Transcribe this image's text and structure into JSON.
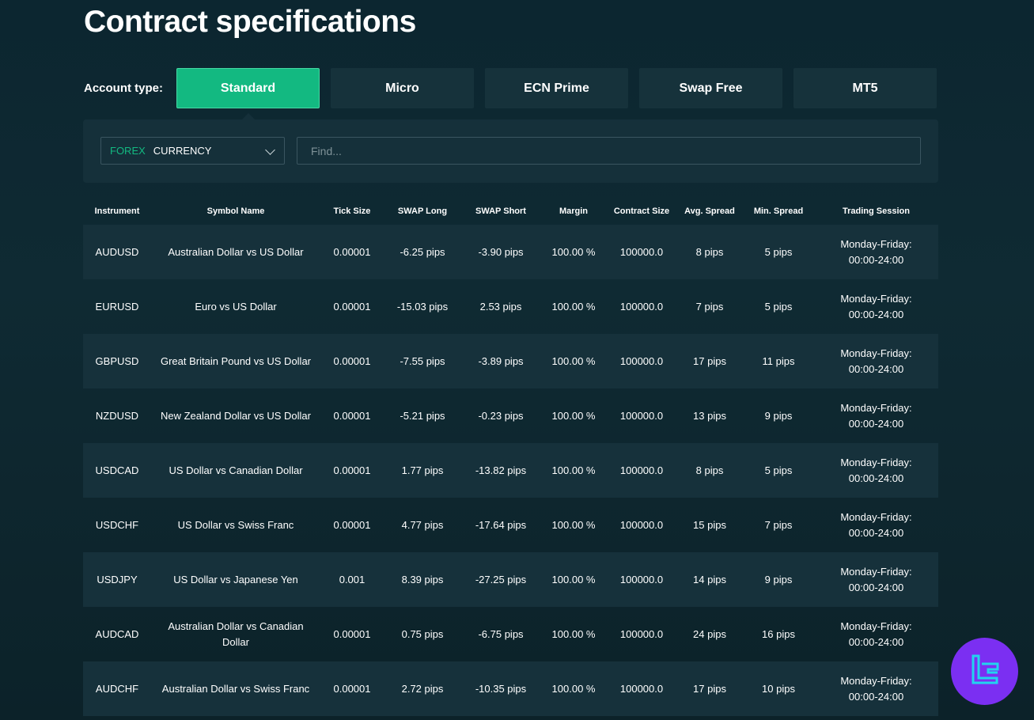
{
  "page": {
    "title": "Contract specifications"
  },
  "account": {
    "label": "Account type:",
    "tabs": [
      {
        "label": "Standard",
        "active": true
      },
      {
        "label": "Micro",
        "active": false
      },
      {
        "label": "ECN Prime",
        "active": false
      },
      {
        "label": "Swap Free",
        "active": false
      },
      {
        "label": "MT5",
        "active": false
      }
    ]
  },
  "filter": {
    "category_tag": "FOREX",
    "category_value": "CURRENCY",
    "find_placeholder": "Find..."
  },
  "table": {
    "headers": [
      "Instrument",
      "Symbol Name",
      "Tick Size",
      "SWAP Long",
      "SWAP Short",
      "Margin",
      "Contract Size",
      "Avg. Spread",
      "Min. Spread",
      "Trading Session"
    ],
    "rows": [
      {
        "instrument": "AUDUSD",
        "symbol": "Australian Dollar vs US Dollar",
        "tick": "0.00001",
        "swap_long": "-6.25 pips",
        "swap_short": "-3.90 pips",
        "margin": "100.00 %",
        "contract": "100000.0",
        "avg": "8 pips",
        "min": "5 pips",
        "session1": "Monday-Friday:",
        "session2": "00:00-24:00"
      },
      {
        "instrument": "EURUSD",
        "symbol": "Euro vs US Dollar",
        "tick": "0.00001",
        "swap_long": "-15.03 pips",
        "swap_short": "2.53 pips",
        "margin": "100.00 %",
        "contract": "100000.0",
        "avg": "7 pips",
        "min": "5 pips",
        "session1": "Monday-Friday:",
        "session2": "00:00-24:00"
      },
      {
        "instrument": "GBPUSD",
        "symbol": "Great Britain Pound vs US Dollar",
        "tick": "0.00001",
        "swap_long": "-7.55 pips",
        "swap_short": "-3.89 pips",
        "margin": "100.00 %",
        "contract": "100000.0",
        "avg": "17 pips",
        "min": "11 pips",
        "session1": "Monday-Friday:",
        "session2": "00:00-24:00"
      },
      {
        "instrument": "NZDUSD",
        "symbol": "New Zealand Dollar vs US Dollar",
        "tick": "0.00001",
        "swap_long": "-5.21 pips",
        "swap_short": "-0.23 pips",
        "margin": "100.00 %",
        "contract": "100000.0",
        "avg": "13 pips",
        "min": "9 pips",
        "session1": "Monday-Friday:",
        "session2": "00:00-24:00"
      },
      {
        "instrument": "USDCAD",
        "symbol": "US Dollar vs Canadian Dollar",
        "tick": "0.00001",
        "swap_long": "1.77 pips",
        "swap_short": "-13.82 pips",
        "margin": "100.00 %",
        "contract": "100000.0",
        "avg": "8 pips",
        "min": "5 pips",
        "session1": "Monday-Friday:",
        "session2": "00:00-24:00"
      },
      {
        "instrument": "USDCHF",
        "symbol": "US Dollar vs Swiss Franc",
        "tick": "0.00001",
        "swap_long": "4.77 pips",
        "swap_short": "-17.64 pips",
        "margin": "100.00 %",
        "contract": "100000.0",
        "avg": "15 pips",
        "min": "7 pips",
        "session1": "Monday-Friday:",
        "session2": "00:00-24:00"
      },
      {
        "instrument": "USDJPY",
        "symbol": "US Dollar vs Japanese Yen",
        "tick": "0.001",
        "swap_long": "8.39 pips",
        "swap_short": "-27.25 pips",
        "margin": "100.00 %",
        "contract": "100000.0",
        "avg": "14 pips",
        "min": "9 pips",
        "session1": "Monday-Friday:",
        "session2": "00:00-24:00"
      },
      {
        "instrument": "AUDCAD",
        "symbol": "Australian Dollar vs Canadian Dollar",
        "tick": "0.00001",
        "swap_long": "0.75 pips",
        "swap_short": "-6.75 pips",
        "margin": "100.00 %",
        "contract": "100000.0",
        "avg": "24 pips",
        "min": "16 pips",
        "session1": "Monday-Friday:",
        "session2": "00:00-24:00"
      },
      {
        "instrument": "AUDCHF",
        "symbol": "Australian Dollar vs Swiss Franc",
        "tick": "0.00001",
        "swap_long": "2.72 pips",
        "swap_short": "-10.35 pips",
        "margin": "100.00 %",
        "contract": "100000.0",
        "avg": "17 pips",
        "min": "10 pips",
        "session1": "Monday-Friday:",
        "session2": "00:00-24:00"
      }
    ]
  },
  "colors": {
    "accent": "#13b981",
    "background": "#0f2a33",
    "row_alt": "#16313b",
    "badge": "#7b2ff2"
  },
  "badge": {
    "icon": "tc-logo-icon"
  }
}
